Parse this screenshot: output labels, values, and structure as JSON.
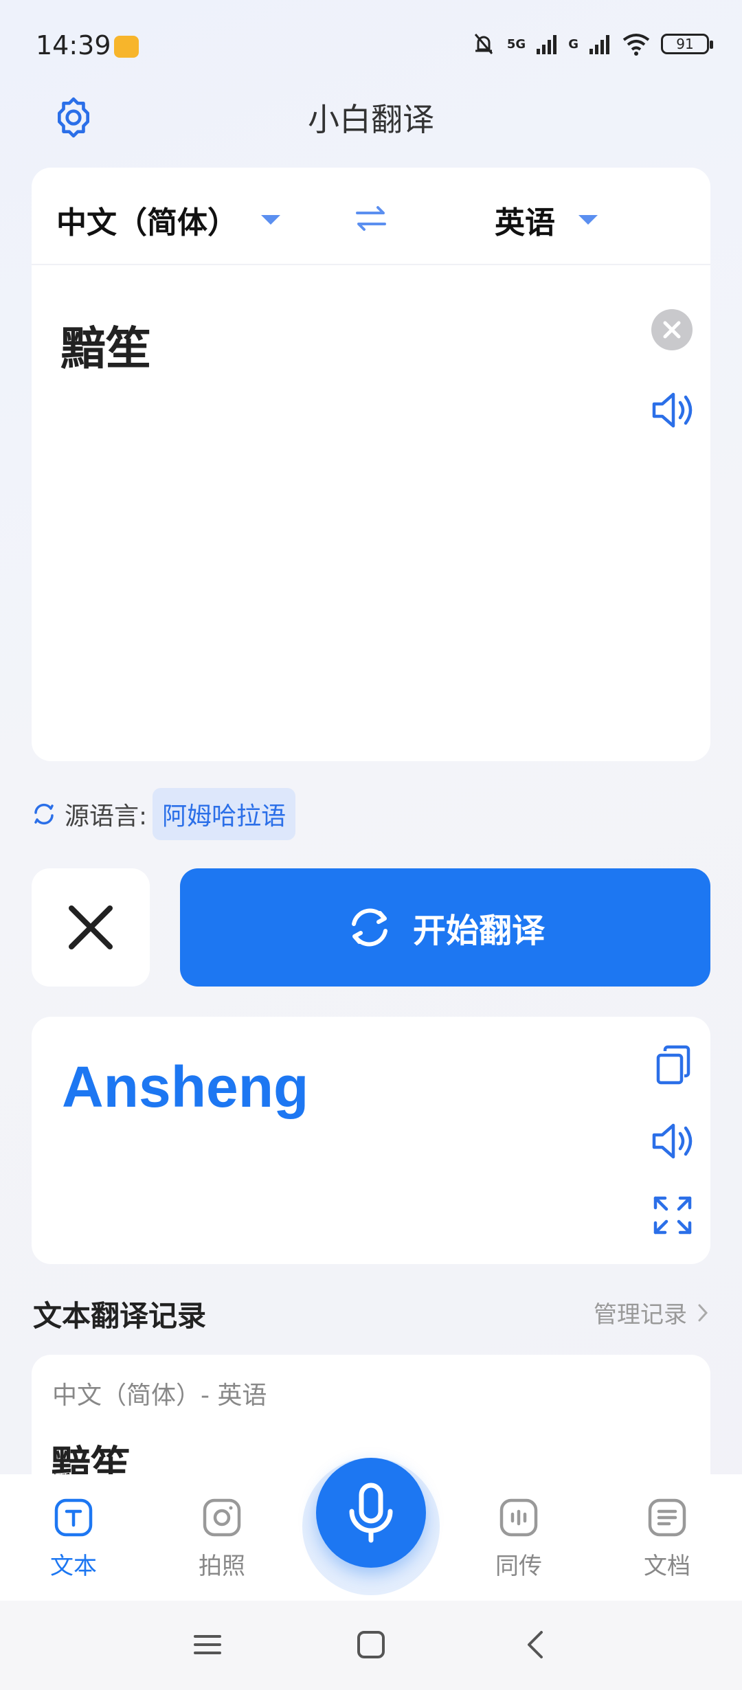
{
  "status_bar": {
    "time": "14:39",
    "network_1": "5G",
    "network_2": "G",
    "battery": "91"
  },
  "header": {
    "title": "小白翻译",
    "settings_icon": "gear-icon"
  },
  "language_bar": {
    "source_language": "中文（简体）",
    "target_language": "英语",
    "swap_icon": "swap-arrows-icon"
  },
  "input": {
    "text": "黯笙"
  },
  "source_detect": {
    "label": "源语言:",
    "detected": "阿姆哈拉语"
  },
  "actions": {
    "translate_label": "开始翻译"
  },
  "result": {
    "text": "Ansheng"
  },
  "history": {
    "title": "文本翻译记录",
    "manage_label": "管理记录",
    "items": [
      {
        "languages": "中文（简体）- 英语",
        "text": "黯笙"
      }
    ]
  },
  "bottom_nav": {
    "items": [
      {
        "label": "文本",
        "icon": "text-icon",
        "active": true
      },
      {
        "label": "拍照",
        "icon": "camera-icon",
        "active": false
      },
      {
        "label": "同传",
        "icon": "interpret-icon",
        "active": false
      },
      {
        "label": "文档",
        "icon": "document-icon",
        "active": false
      }
    ],
    "mic_icon": "microphone-icon"
  },
  "colors": {
    "accent": "#1d77f2",
    "badge_bg": "#dde7fb"
  }
}
